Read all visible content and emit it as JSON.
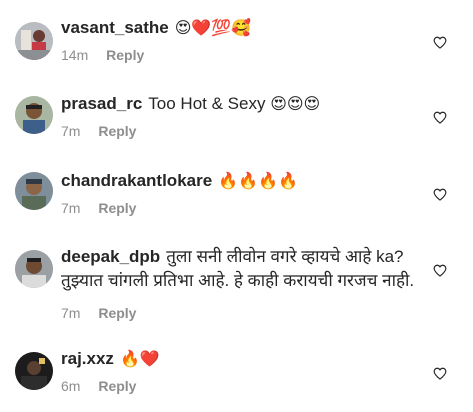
{
  "comments": [
    {
      "username": "vasant_sathe",
      "text": "",
      "emojis": "😍❤️💯🥰",
      "time": "14m",
      "reply": "Reply",
      "avatar": "avatar-1"
    },
    {
      "username": "prasad_rc",
      "text": "Too Hot & Sexy",
      "emojis": "😍😍😍",
      "time": "7m",
      "reply": "Reply",
      "avatar": "avatar-2"
    },
    {
      "username": "chandrakantlokare",
      "text": "",
      "emojis": "🔥🔥🔥🔥",
      "time": "7m",
      "reply": "Reply",
      "avatar": "avatar-3"
    },
    {
      "username": "deepak_dpb",
      "text": "तुला सनी लीवोन वगरे व्हायचे आहे ka? तुझ्यात चांगली प्रतिभा आहे. हे काही करायची गरजच नाही.",
      "emojis": "",
      "time": "7m",
      "reply": "Reply",
      "avatar": "avatar-4"
    },
    {
      "username": "raj.xxz",
      "text": "",
      "emojis": "🔥❤️",
      "time": "6m",
      "reply": "Reply",
      "avatar": "avatar-5"
    }
  ],
  "icons": {
    "like": "heart-outline-icon"
  },
  "colors": {
    "text": "#262626",
    "secondary": "#8e8e8e",
    "background": "#ffffff"
  }
}
